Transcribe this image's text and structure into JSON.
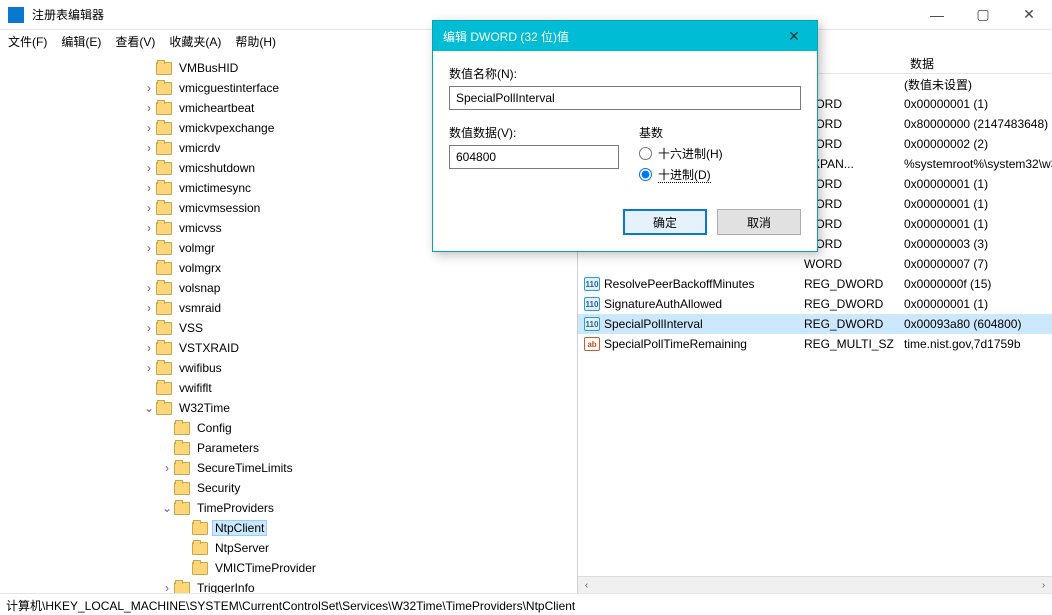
{
  "titlebar": {
    "title": "注册表编辑器"
  },
  "menubar": {
    "file": "文件(F)",
    "edit": "编辑(E)",
    "view": "查看(V)",
    "favorites": "收藏夹(A)",
    "help": "帮助(H)"
  },
  "tree": [
    {
      "depth": 3,
      "exp": "",
      "label": "VMBusHID"
    },
    {
      "depth": 3,
      "exp": "›",
      "label": "vmicguestinterface"
    },
    {
      "depth": 3,
      "exp": "›",
      "label": "vmicheartbeat"
    },
    {
      "depth": 3,
      "exp": "›",
      "label": "vmickvpexchange"
    },
    {
      "depth": 3,
      "exp": "›",
      "label": "vmicrdv"
    },
    {
      "depth": 3,
      "exp": "›",
      "label": "vmicshutdown"
    },
    {
      "depth": 3,
      "exp": "›",
      "label": "vmictimesync"
    },
    {
      "depth": 3,
      "exp": "›",
      "label": "vmicvmsession"
    },
    {
      "depth": 3,
      "exp": "›",
      "label": "vmicvss"
    },
    {
      "depth": 3,
      "exp": "›",
      "label": "volmgr"
    },
    {
      "depth": 3,
      "exp": "",
      "label": "volmgrx"
    },
    {
      "depth": 3,
      "exp": "›",
      "label": "volsnap"
    },
    {
      "depth": 3,
      "exp": "›",
      "label": "vsmraid"
    },
    {
      "depth": 3,
      "exp": "›",
      "label": "VSS"
    },
    {
      "depth": 3,
      "exp": "›",
      "label": "VSTXRAID"
    },
    {
      "depth": 3,
      "exp": "›",
      "label": "vwifibus"
    },
    {
      "depth": 3,
      "exp": "",
      "label": "vwififlt"
    },
    {
      "depth": 3,
      "exp": "⌄",
      "label": "W32Time"
    },
    {
      "depth": 4,
      "exp": "",
      "label": "Config"
    },
    {
      "depth": 4,
      "exp": "",
      "label": "Parameters"
    },
    {
      "depth": 4,
      "exp": "›",
      "label": "SecureTimeLimits"
    },
    {
      "depth": 4,
      "exp": "",
      "label": "Security"
    },
    {
      "depth": 4,
      "exp": "⌄",
      "label": "TimeProviders"
    },
    {
      "depth": 5,
      "exp": "",
      "label": "NtpClient",
      "selected": true
    },
    {
      "depth": 5,
      "exp": "",
      "label": "NtpServer"
    },
    {
      "depth": 5,
      "exp": "",
      "label": "VMICTimeProvider"
    },
    {
      "depth": 4,
      "exp": "›",
      "label": "TriggerInfo"
    }
  ],
  "list": {
    "header": {
      "name": "",
      "type": "",
      "data": "数据"
    },
    "rows": [
      {
        "name": "",
        "type": "",
        "data": "(数值未设置)",
        "partial": true,
        "typepartial": "Z"
      },
      {
        "name": "",
        "type": "",
        "data": "0x00000001 (1)",
        "partial": true,
        "typepartial": "WORD"
      },
      {
        "name": "",
        "type": "",
        "data": "0x80000000 (2147483648)",
        "partial": true,
        "typepartial": "WORD"
      },
      {
        "name": "",
        "type": "",
        "data": "0x00000002 (2)",
        "partial": true,
        "typepartial": "WORD"
      },
      {
        "name": "",
        "type": "",
        "data": "%systemroot%\\system32\\w3",
        "partial": true,
        "typepartial": "EXPAN..."
      },
      {
        "name": "",
        "type": "",
        "data": "0x00000001 (1)",
        "partial": true,
        "typepartial": "WORD"
      },
      {
        "name": "",
        "type": "",
        "data": "0x00000001 (1)",
        "partial": true,
        "typepartial": "WORD"
      },
      {
        "name": "",
        "type": "",
        "data": "0x00000001 (1)",
        "partial": true,
        "typepartial": "WORD"
      },
      {
        "name": "",
        "type": "",
        "data": "0x00000003 (3)",
        "partial": true,
        "typepartial": "WORD"
      },
      {
        "name": "",
        "type": "",
        "data": "0x00000007 (7)",
        "partial": true,
        "typepartial": "WORD"
      },
      {
        "name": "ResolvePeerBackoffMinutes",
        "type": "REG_DWORD",
        "data": "0x0000000f (15)"
      },
      {
        "name": "SignatureAuthAllowed",
        "type": "REG_DWORD",
        "data": "0x00000001 (1)"
      },
      {
        "name": "SpecialPollInterval",
        "type": "REG_DWORD",
        "data": "0x00093a80 (604800)",
        "selected": true
      },
      {
        "name": "SpecialPollTimeRemaining",
        "type": "REG_MULTI_SZ",
        "data": "time.nist.gov,7d1759b"
      }
    ]
  },
  "dialog": {
    "title": "编辑 DWORD (32 位)值",
    "name_label": "数值名称(N):",
    "name_value": "SpecialPollInterval",
    "data_label": "数值数据(V):",
    "data_value": "604800",
    "base_label": "基数",
    "hex_label": "十六进制(H)",
    "dec_label": "十进制(D)",
    "ok": "确定",
    "cancel": "取消"
  },
  "statusbar": {
    "path": "计算机\\HKEY_LOCAL_MACHINE\\SYSTEM\\CurrentControlSet\\Services\\W32Time\\TimeProviders\\NtpClient"
  }
}
